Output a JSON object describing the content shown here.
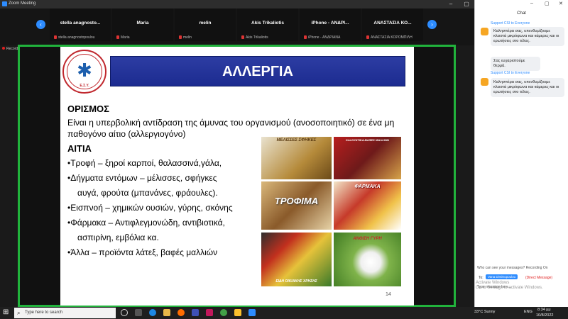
{
  "window": {
    "title": "Zoom Meeting"
  },
  "participants": [
    {
      "name": "stella  anagnosto...",
      "sub": "stella anagnostopoulou"
    },
    {
      "name": "Maria",
      "sub": "Maria"
    },
    {
      "name": "melin",
      "sub": "melin"
    },
    {
      "name": "Akis Trikaliotis",
      "sub": "Akis Trikaliotis"
    },
    {
      "name": "iPhone - ΑΝΔΡΙ...",
      "sub": "iPhone - ΑΝΔΡΙΑΝΑ"
    },
    {
      "name": "ΑΝΑΣΤΑΣΙΑ ΚΟ...",
      "sub": "ΑΝΑΣΤΑΣΙΑ ΚΟΡΟΜΠΙΛΗ"
    }
  ],
  "recording_label": "Recording",
  "slide": {
    "logo_text": "Ε.Σ.Υ.",
    "title": "ΑΛΛΕΡΓΙΑ",
    "definition_heading": "ΟΡΙΣΜΟΣ",
    "definition_text": "Είναι η υπερβολική αντίδραση της άμυνας του οργανισμού (ανοσοποιητικό) σε ένα μη παθογόνο αίτιο (αλλεργιογόνο)",
    "causes_heading": "ΑΙΤΙΑ",
    "bullets": [
      "•Τροφή – ξηροί καρποί, θαλασσινά,γάλα,",
      "•Δήγματα εντόμων – μέλισσες, σφήγκες",
      "αυγά, φρούτα (μπανάνες, φράουλες).",
      "•Εισπνοή – χημικών ουσιών, γύρης, σκόνης",
      "•Φάρμακα – Αντιφλεγμονώδη, αντιβιοτικά,",
      "ασπιρίνη, εμβόλια κα.",
      "•Άλλα – προϊόντα λάτεξ, βαφές μαλλιών"
    ],
    "photo_captions": [
      "ΜΕΛΙΣΣΕΣ ΣΦΗΚΕΣ",
      "ΚΑΛΛΥΝΤΙΚΑ-ΒΑΦΕΣ ΜΑΛΛΙΩΝ",
      "ΤΡΟΦΙΜΑ",
      "ΦΑΡΜΑΚΑ",
      "ΕΙΔΗ ΟΙΚΙΑΚΗΣ ΧΡΗΣΗΣ",
      "ΑΝΘΙΣΗ ΓΥΡΗ"
    ],
    "page_number": "14"
  },
  "chat": {
    "title": "Chat",
    "messages": [
      {
        "from": "Support CSI to Everyone",
        "text": "Καλησπέρα σας, υπενθυμίζουμε κλειστά μικρόφωνα και κάμερες και οι ερωτήσεις στο τέλος."
      },
      {
        "from": "",
        "text": "Σας ευχαριστούμε θερμά."
      },
      {
        "from": "Support CSI to Everyone",
        "text": "Καλησπέρα σας, υπενθυμίζουμε κλειστά μικρόφωνα και κάμερες και οι ερωτήσεις στο τέλος."
      }
    ],
    "who_can_see": "Who can see your messages? Recording On",
    "to_label": "To:",
    "recipient": "Vana Dimitropoulou",
    "direct_label": "(Direct Message)",
    "input_placeholder": "Type message here...",
    "watermark_line1": "Activate Windows",
    "watermark_line2": "Go to Settings to activate Windows."
  },
  "taskbar": {
    "search_placeholder": "Type here to search",
    "weather": "33°C  Sunny",
    "lang": "ENG",
    "time": "8:34 μμ",
    "date": "10/8/2022"
  }
}
